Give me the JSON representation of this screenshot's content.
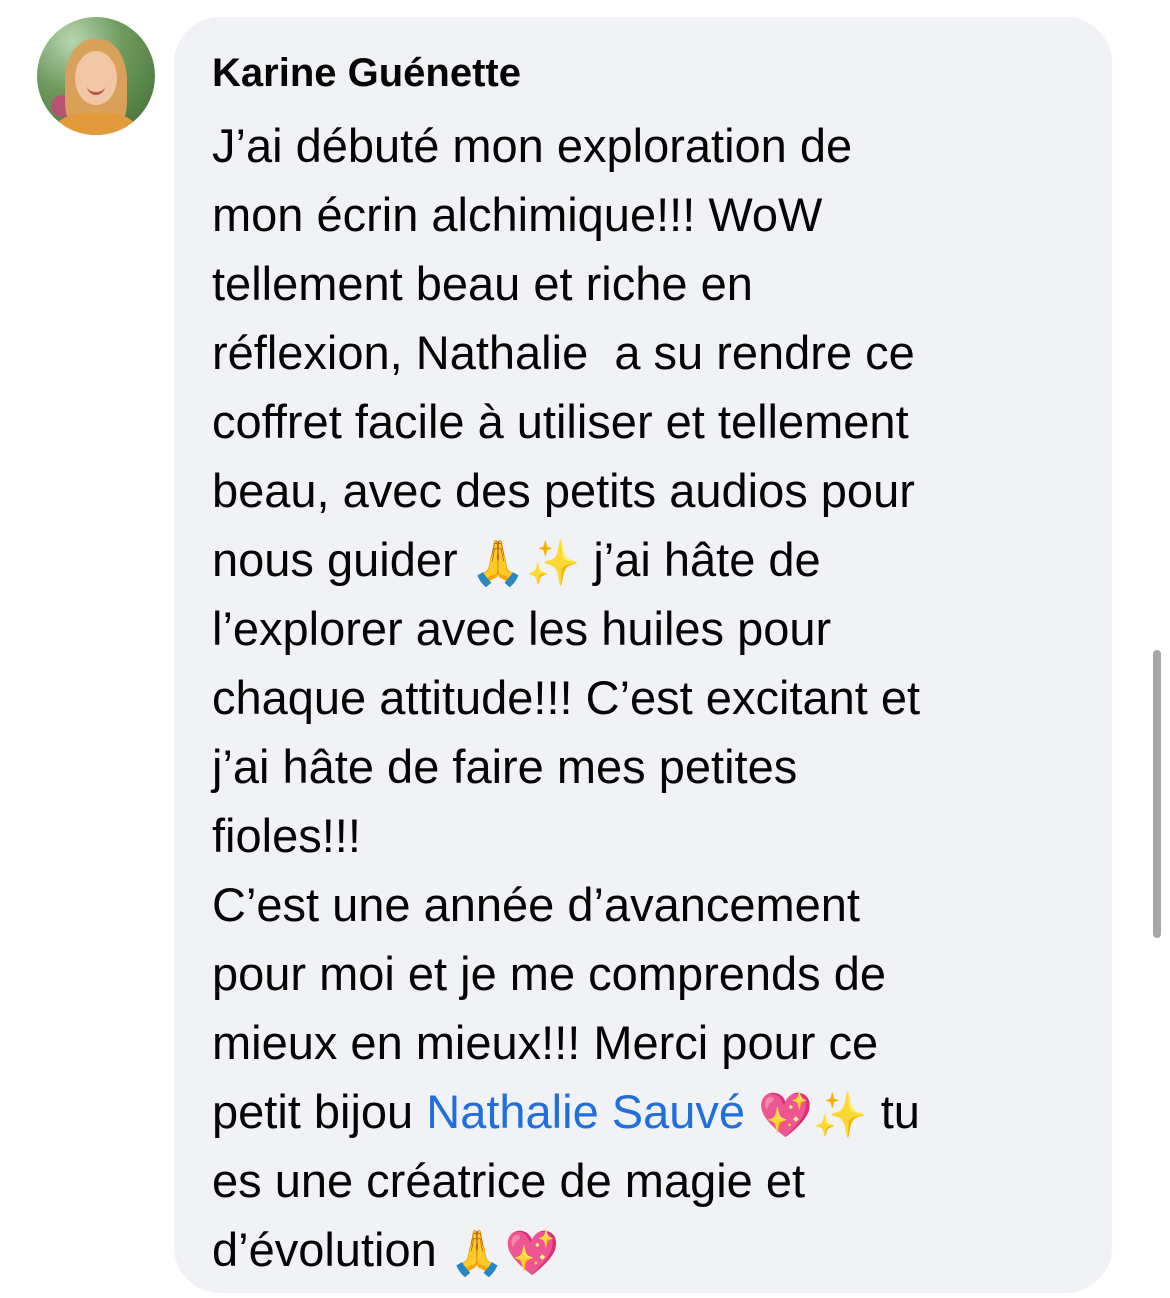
{
  "comment": {
    "author": "Karine Guénette",
    "avatar_icon": "profile-photo",
    "lines": [
      [
        "J’ai débuté mon exploration de"
      ],
      [
        "mon écrin alchimique!!! WoW"
      ],
      [
        "tellement beau et riche en"
      ],
      [
        "réflexion, Nathalie  a su rendre ce"
      ],
      [
        "coffret facile à utiliser et tellement"
      ],
      [
        "beau, avec des petits audios pour"
      ],
      [
        "nous guider ",
        "🙏",
        "✨",
        " j’ai hâte de"
      ],
      [
        "l’explorer avec les huiles pour"
      ],
      [
        "chaque attitude!!! C’est excitant et"
      ],
      [
        "j’ai hâte de faire mes petites"
      ],
      [
        "fioles!!!"
      ],
      [
        "C’est une année d’avancement"
      ],
      [
        "pour moi et je me comprends de"
      ],
      [
        "mieux en mieux!!! Merci pour ce"
      ],
      [
        "petit bijou ",
        "Nathalie Sauvé",
        " ",
        "💖",
        "✨",
        " tu"
      ],
      [
        "es une créatrice de magie et"
      ],
      [
        "d’évolution ",
        "🙏",
        "💖"
      ]
    ],
    "mention_color": "#216fdb",
    "bubble_color": "#f0f2f5"
  }
}
